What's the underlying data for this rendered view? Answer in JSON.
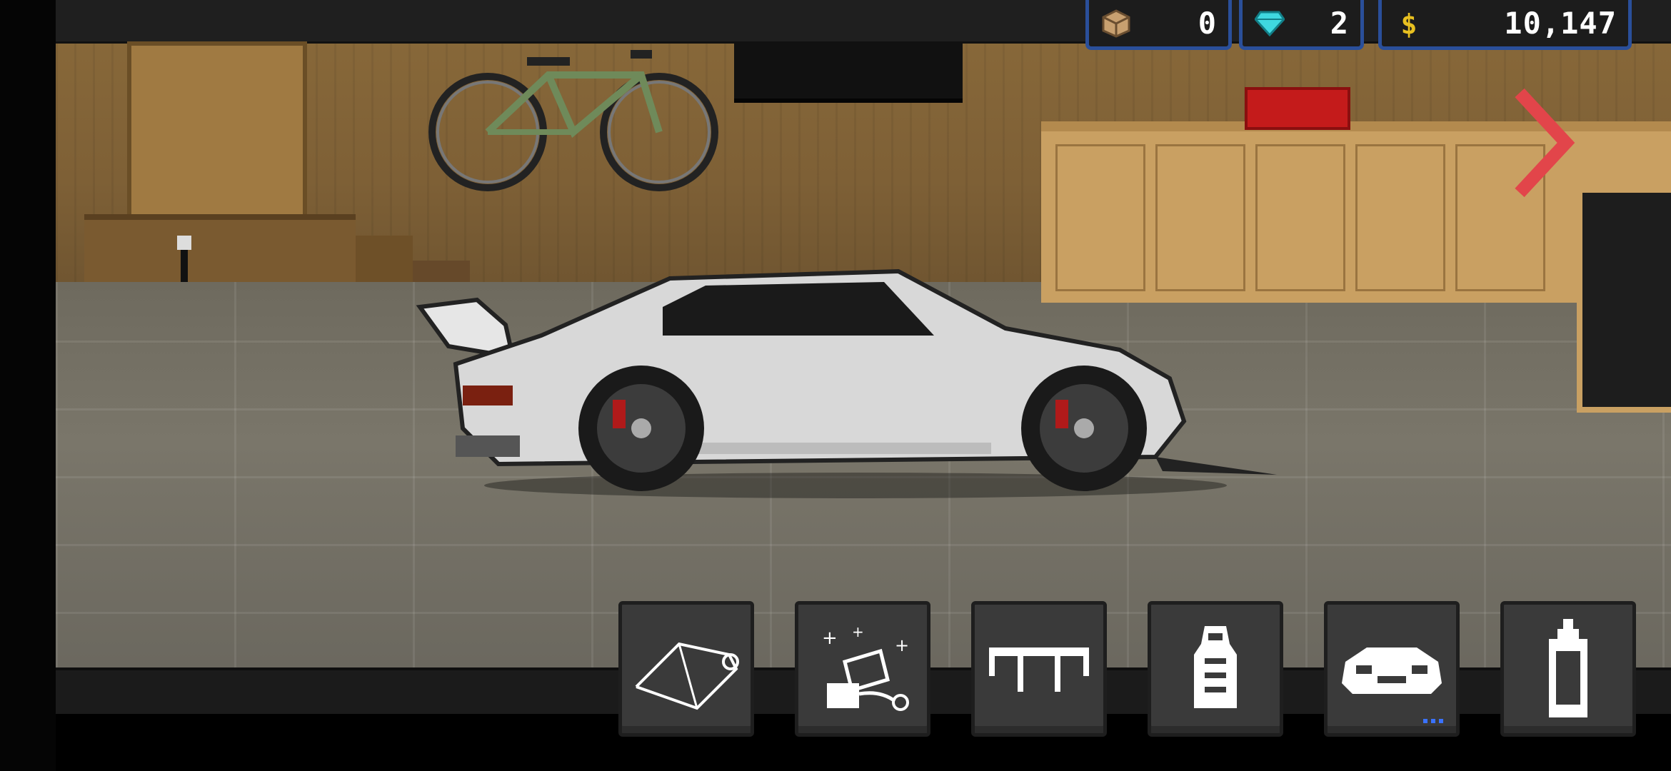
{
  "currency": {
    "parts": {
      "icon": "crate-icon",
      "value": "0"
    },
    "gems": {
      "icon": "diamond-icon",
      "value": "2"
    },
    "cash": {
      "icon": "dollar-icon",
      "value": "10,147"
    }
  },
  "toolbar": {
    "buttons": [
      {
        "id": "wrap",
        "icon": "wrap-film-icon"
      },
      {
        "id": "paint-shop",
        "icon": "paint-bucket-icon"
      },
      {
        "id": "spoiler",
        "icon": "spoiler-icon"
      },
      {
        "id": "seat",
        "icon": "seat-icon"
      },
      {
        "id": "body-kit",
        "icon": "car-front-icon",
        "has_more": true
      },
      {
        "id": "spray",
        "icon": "spray-can-icon"
      }
    ]
  },
  "colors": {
    "hud_border": "#2a4f9a",
    "next_arrow": "#e2454a",
    "car_body": "#d8d8d8"
  }
}
